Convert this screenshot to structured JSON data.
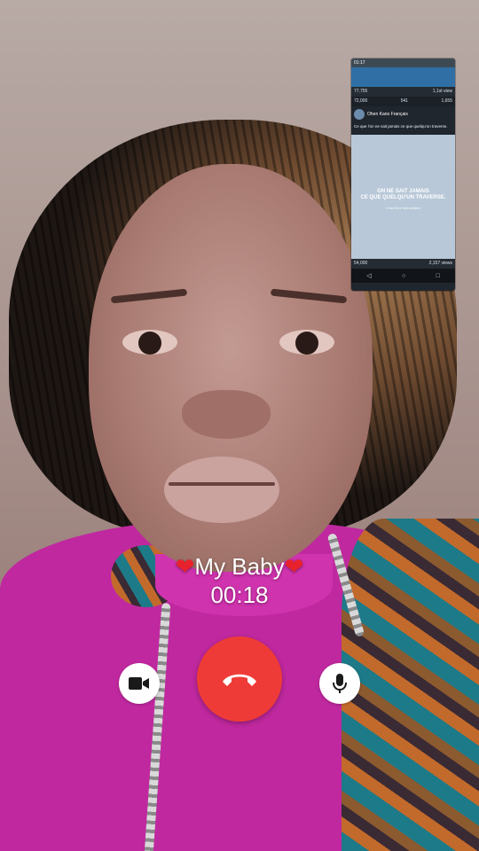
{
  "call": {
    "caller_name": "My Baby",
    "heart_left": "❤",
    "heart_right": "❤",
    "duration": "00:18"
  },
  "controls": {
    "video_icon": "video-camera-icon",
    "end_icon": "end-call-icon",
    "mic_icon": "microphone-icon",
    "end_color": "#ef3b37"
  },
  "pip": {
    "status_time": "01:17",
    "row1_left": "77,755",
    "row1_right": "1,1st view",
    "row2_left": "72,000",
    "row2_mid": "541",
    "row2_right": "1,655",
    "author": "Ohen Kano Français",
    "caption": "Ce que l'on ne sait jamais ce que quelqu'un traverse.",
    "image_line1": "ON NE SAIT JAMAIS",
    "image_line2": "CE QUE QUELQU'UN TRAVERSE.",
    "image_small": "Il faut être bienveillant",
    "row3_left": "54,000",
    "row3_right": "2,157 views"
  }
}
